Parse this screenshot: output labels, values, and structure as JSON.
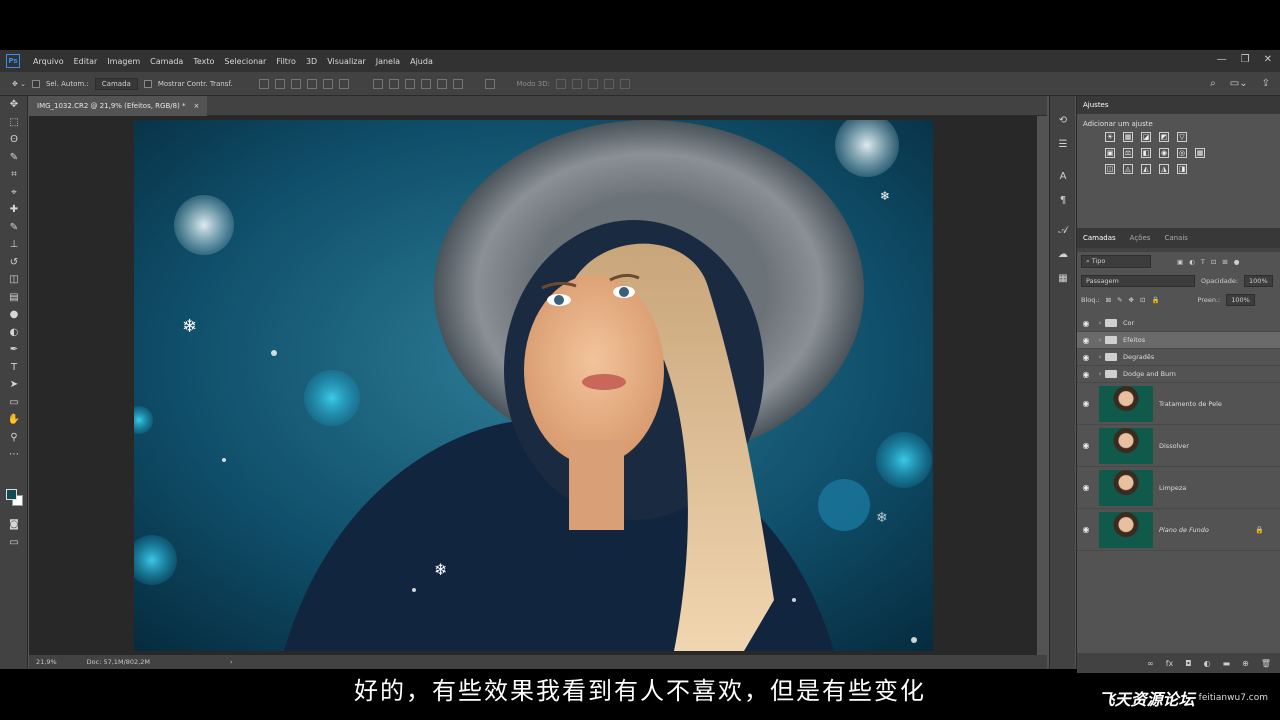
{
  "menu": [
    "Arquivo",
    "Editar",
    "Imagem",
    "Camada",
    "Texto",
    "Selecionar",
    "Filtro",
    "3D",
    "Visualizar",
    "Janela",
    "Ajuda"
  ],
  "app_logo": "Ps",
  "window_controls": [
    "—",
    "❐",
    "✕"
  ],
  "options_bar": {
    "auto_select_label": "Sel. Autom.:",
    "auto_select_value": "Camada",
    "show_transform_label": "Mostrar Contr. Transf.",
    "mode_3d_label": "Modo 3D:"
  },
  "tools": [
    "move-icon",
    "marquee-icon",
    "lasso-icon",
    "quick-select-icon",
    "crop-icon",
    "eyedropper-icon",
    "healing-brush-icon",
    "brush-icon",
    "clone-stamp-icon",
    "history-brush-icon",
    "eraser-icon",
    "gradient-icon",
    "blur-icon",
    "dodge-icon",
    "pen-icon",
    "type-icon",
    "path-select-icon",
    "shape-icon",
    "hand-icon",
    "zoom-icon",
    "more-tools-icon"
  ],
  "tool_glyphs": [
    "✥",
    "⬚",
    "ʘ",
    "✎",
    "⌗",
    "⌖",
    "✚",
    "✎",
    "⊥",
    "↺",
    "◫",
    "▤",
    "●",
    "◐",
    "✒",
    "T",
    "➤",
    "▭",
    "✋",
    "⚲",
    "⋯"
  ],
  "colors": {
    "foreground": "#0e4b55",
    "background": "#ffffff",
    "accent": "#3a8ee6"
  },
  "document": {
    "tab_title": "IMG_1032.CR2 @ 21,9% (Efeitos, RGB/8) *",
    "close": "×"
  },
  "status": {
    "zoom": "21,9%",
    "doc": "Doc: 57,1M/802,2M",
    "arrow": "›"
  },
  "adjustments": {
    "tab": "Ajustes",
    "title": "Adicionar um ajuste",
    "row1": [
      "☀",
      "▦",
      "◪",
      "◩",
      "▽"
    ],
    "row2": [
      "▣",
      "⚖",
      "◧",
      "◉",
      "◎",
      "▦"
    ],
    "row3": [
      "◫",
      "◬",
      "◭",
      "◮",
      "◨"
    ]
  },
  "layers_panel": {
    "tabs": [
      "Camadas",
      "Ações",
      "Canais"
    ],
    "filter_label": "⌕ Tipo",
    "blend_mode": "Passagem",
    "opacity_label": "Opacidade:",
    "opacity_value": "100%",
    "lock_label": "Bloq.:",
    "fill_label": "Preen.:",
    "fill_value": "100%",
    "groups": [
      {
        "name": "Cor",
        "selected": false
      },
      {
        "name": "Efeitos",
        "selected": true
      },
      {
        "name": "Degradês",
        "selected": false
      },
      {
        "name": "Dodge and Burn",
        "selected": false
      }
    ],
    "layers": [
      {
        "name": "Tratamento de Pele",
        "locked": false
      },
      {
        "name": "Dissolver",
        "locked": false
      },
      {
        "name": "Limpeza",
        "locked": false
      },
      {
        "name": "Plano de Fundo",
        "locked": true
      }
    ],
    "footer_icons": [
      "∞",
      "fx",
      "◘",
      "◐",
      "▬",
      "⊕",
      "🗑"
    ]
  },
  "subtitle": "好的，有些效果我看到有人不喜欢，但是有些变化",
  "watermark": {
    "cn": "飞天资源论坛",
    "url": "feitianwu7.com"
  }
}
